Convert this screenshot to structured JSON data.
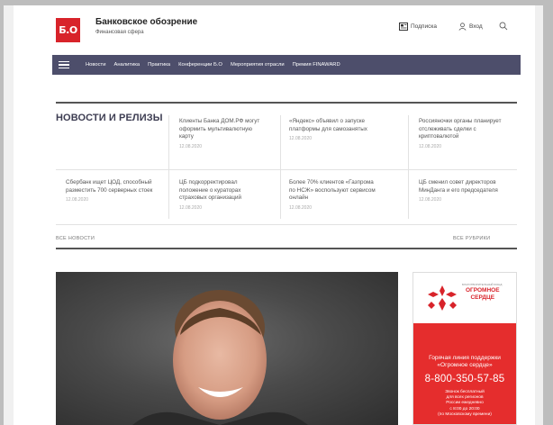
{
  "header": {
    "logo_text": "Б.О",
    "brand_name": "Банковское обозрение",
    "brand_sub": "Финансовая сфера",
    "subscribe": "Подписка",
    "login": "Вход"
  },
  "nav": {
    "items": [
      "Новости",
      "Аналитика",
      "Практика",
      "Конференции Б.О",
      "Мероприятия отрасли",
      "Премия FINAWARD"
    ]
  },
  "news": {
    "title": "НОВОСТИ И РЕЛИЗЫ",
    "items": [
      {
        "headline": "Клиенты Банка ДОМ.РФ могут оформить мультивалютную карту",
        "date": "12.08.2020"
      },
      {
        "headline": "«Яндекс» объявил о запуске платформы для самозанятых",
        "date": "12.08.2020"
      },
      {
        "headline": "Россияночки органы планирует отслеживать сделки с криптовалютой",
        "date": "12.08.2020"
      },
      {
        "headline": "Сбербанк ищет ЦОД, способный разместить 700 серверных стоек",
        "date": "12.08.2020"
      },
      {
        "headline": "ЦБ подкорректировал положение о кураторах страховых организаций",
        "date": "12.08.2020"
      },
      {
        "headline": "Более 70% клиентов «Газпрома по НСЖ» воспользуют сервисом онлайн",
        "date": "12.08.2020"
      },
      {
        "headline": "ЦБ сменил совет директоров МинДанга и его председателя",
        "date": "12.08.2020"
      }
    ],
    "all_news": "ВСЕ НОВОСТИ",
    "all_rubrics": "ВСЕ РУБРИКИ"
  },
  "ad": {
    "org_small": "БЛАГОТВОРИТЕЛЬНЫЙ ФОНД",
    "org_line1": "ОГРОМНОЕ",
    "org_line2": "СЕРДЦЕ",
    "hotline_1": "Горячая линия поддержки",
    "hotline_2": "«Огромное сердце»",
    "phone": "8-800-350-57-85",
    "note_1": "Звонок бесплатный",
    "note_2": "для всех регионов",
    "note_3": "России ежедневно",
    "note_4": "с 8:00 до 20:00",
    "note_5": "(по Московскому времени)"
  },
  "colors": {
    "brand_red": "#d8232a",
    "nav_bg": "#4d4e6b",
    "ad_red": "#e52d2d"
  }
}
